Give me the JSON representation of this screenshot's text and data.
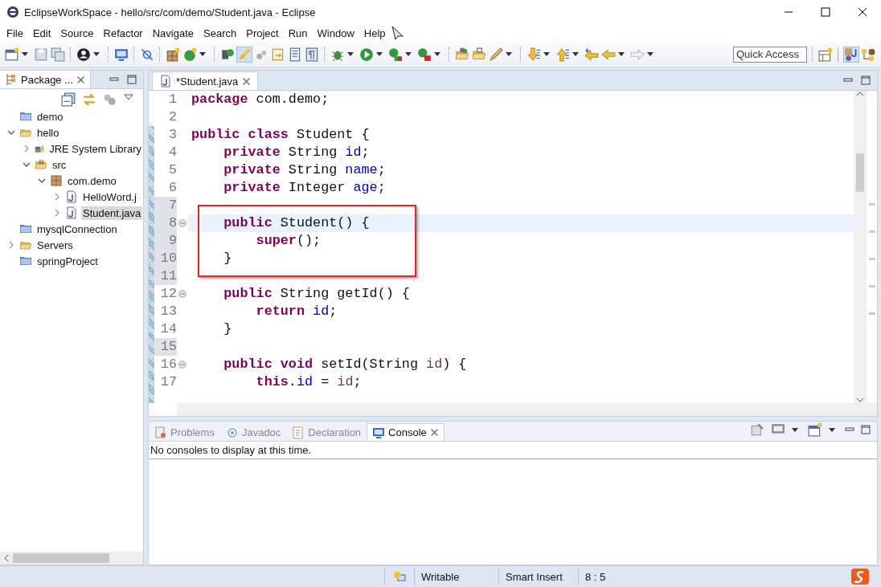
{
  "window": {
    "title": "EclipseWorkSpace - hello/src/com/demo/Student.java - Eclipse"
  },
  "menu": [
    "File",
    "Edit",
    "Source",
    "Refactor",
    "Navigate",
    "Search",
    "Project",
    "Run",
    "Window",
    "Help"
  ],
  "quick_access": {
    "placeholder": "Quick Access"
  },
  "package_explorer": {
    "title": "Package ...",
    "tree": [
      {
        "label": "demo",
        "kind": "project",
        "selected": false
      },
      {
        "label": "hello",
        "kind": "project-open",
        "selected": false,
        "expanded": true,
        "children": [
          {
            "label": "JRE System Library",
            "kind": "library",
            "selected": false,
            "expanded": false
          },
          {
            "label": "src",
            "kind": "source-folder",
            "selected": false,
            "expanded": true,
            "children": [
              {
                "label": "com.demo",
                "kind": "package",
                "selected": false,
                "expanded": true,
                "children": [
                  {
                    "label": "HelloWord.j",
                    "kind": "java-file",
                    "selected": false,
                    "expanded": false
                  },
                  {
                    "label": "Student.java",
                    "kind": "java-file",
                    "selected": true,
                    "expanded": false
                  }
                ]
              }
            ]
          }
        ]
      },
      {
        "label": "mysqlConnection",
        "kind": "project",
        "selected": false
      },
      {
        "label": "Servers",
        "kind": "project-open",
        "selected": false,
        "expanded": false
      },
      {
        "label": "springProject",
        "kind": "project",
        "selected": false
      }
    ]
  },
  "editor": {
    "tab": {
      "label": "*Student.java",
      "selected": true
    },
    "lines": [
      {
        "number": "1",
        "changed": false,
        "current": false,
        "fold": false,
        "boxed": false,
        "tokens": [
          {
            "text": "package",
            "kind": "keyword"
          },
          {
            "text": " com.demo;",
            "kind": "plain"
          }
        ]
      },
      {
        "number": "2",
        "changed": false,
        "current": false,
        "fold": false,
        "boxed": false
      },
      {
        "number": "3",
        "changed": false,
        "current": false,
        "fold": false,
        "boxed": false,
        "tokens": [
          {
            "text": "public class",
            "kind": "keyword"
          },
          {
            "text": " Student {",
            "kind": "plain"
          }
        ]
      },
      {
        "number": "4",
        "changed": false,
        "current": false,
        "fold": false,
        "boxed": false,
        "tokens": [
          {
            "text": "    private",
            "kind": "keyword"
          },
          {
            "text": " String ",
            "kind": "plain"
          },
          {
            "text": "id",
            "kind": "field"
          },
          {
            "text": ";",
            "kind": "plain"
          }
        ]
      },
      {
        "number": "5",
        "changed": false,
        "current": false,
        "fold": false,
        "boxed": false,
        "tokens": [
          {
            "text": "    private",
            "kind": "keyword"
          },
          {
            "text": " String ",
            "kind": "plain"
          },
          {
            "text": "name",
            "kind": "field"
          },
          {
            "text": ";",
            "kind": "plain"
          }
        ]
      },
      {
        "number": "6",
        "changed": false,
        "current": false,
        "fold": false,
        "boxed": false,
        "tokens": [
          {
            "text": "    private",
            "kind": "keyword"
          },
          {
            "text": " Integer ",
            "kind": "plain"
          },
          {
            "text": "age",
            "kind": "field"
          },
          {
            "text": ";",
            "kind": "plain"
          }
        ]
      },
      {
        "number": "7",
        "changed": true,
        "current": false,
        "fold": false,
        "boxed": false
      },
      {
        "number": "8",
        "changed": true,
        "current": true,
        "fold": true,
        "boxed": true,
        "tokens": [
          {
            "text": "    public",
            "kind": "keyword"
          },
          {
            "text": " Student() {",
            "kind": "plain"
          }
        ]
      },
      {
        "number": "9",
        "changed": true,
        "current": false,
        "fold": false,
        "boxed": true,
        "tokens": [
          {
            "text": "        super",
            "kind": "keyword"
          },
          {
            "text": "();",
            "kind": "plain"
          }
        ]
      },
      {
        "number": "10",
        "changed": true,
        "current": false,
        "fold": false,
        "boxed": true,
        "tokens": [
          {
            "text": "    }",
            "kind": "plain"
          }
        ]
      },
      {
        "number": "11",
        "changed": true,
        "current": false,
        "fold": false,
        "boxed": false
      },
      {
        "number": "12",
        "changed": false,
        "current": false,
        "fold": true,
        "boxed": false,
        "tokens": [
          {
            "text": "    public",
            "kind": "keyword"
          },
          {
            "text": " String getId() {",
            "kind": "plain"
          }
        ]
      },
      {
        "number": "13",
        "changed": false,
        "current": false,
        "fold": false,
        "boxed": false,
        "tokens": [
          {
            "text": "        return ",
            "kind": "keyword"
          },
          {
            "text": "id",
            "kind": "field"
          },
          {
            "text": ";",
            "kind": "plain"
          }
        ]
      },
      {
        "number": "14",
        "changed": false,
        "current": false,
        "fold": false,
        "boxed": false,
        "tokens": [
          {
            "text": "    }",
            "kind": "plain"
          }
        ]
      },
      {
        "number": "15",
        "changed": true,
        "current": false,
        "fold": false,
        "boxed": false
      },
      {
        "number": "16",
        "changed": false,
        "current": false,
        "fold": true,
        "boxed": false,
        "tokens": [
          {
            "text": "    public void",
            "kind": "keyword"
          },
          {
            "text": " setId(String ",
            "kind": "plain"
          },
          {
            "text": "id",
            "kind": "param"
          },
          {
            "text": ") {",
            "kind": "plain"
          }
        ]
      },
      {
        "number": "17",
        "changed": false,
        "current": false,
        "fold": false,
        "boxed": false,
        "tokens": [
          {
            "text": "        this",
            "kind": "keyword"
          },
          {
            "text": ".",
            "kind": "plain"
          },
          {
            "text": "id",
            "kind": "field"
          },
          {
            "text": " = ",
            "kind": "plain"
          },
          {
            "text": "id",
            "kind": "param"
          },
          {
            "text": ";",
            "kind": "plain"
          }
        ]
      }
    ]
  },
  "console": {
    "tabs": [
      {
        "label": "Problems",
        "kind": "problems",
        "selected": false
      },
      {
        "label": "Javadoc",
        "kind": "javadoc",
        "selected": false
      },
      {
        "label": "Declaration",
        "kind": "declaration",
        "selected": false
      },
      {
        "label": "Console",
        "kind": "console",
        "selected": true
      }
    ],
    "message": "No consoles to display at this time."
  },
  "status_bar": {
    "fields": [
      "Writable",
      "Smart Insert",
      "8 : 5"
    ]
  }
}
